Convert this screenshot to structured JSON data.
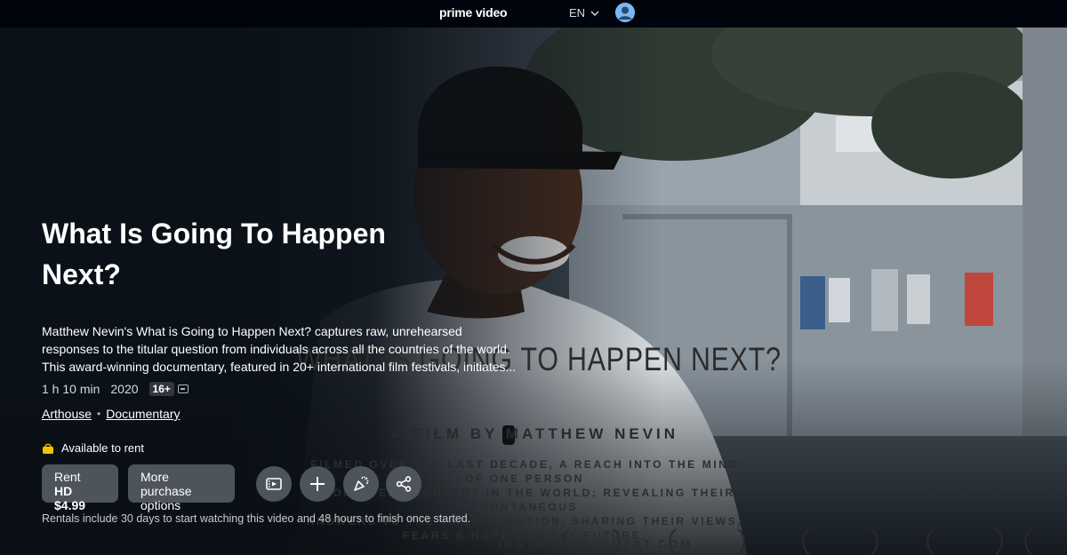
{
  "nav": {
    "brand": "prime video",
    "language": "EN"
  },
  "poster": {
    "title_text": "WHAT IS GOING TO HAPPEN NEXT?",
    "byline": "A FILM BY MATTHEW NEVIN",
    "description": "FILMED OVER THE LAST DECADE, A REACH INTO THE MIND OF ONE PERSON\nFROM EVERY COUNTRY IN THE WORLD; REVEALING THEIR SPONTANEOUS\nANSWERS TO THE TITLE QUESTION, SHARING THEIR VIEWS,\nFEARS & HOPE FOR THE FUTURE.",
    "url": "INGTOHAPPENNEXT.COM"
  },
  "detail": {
    "title": "What Is Going To Happen Next?",
    "synopsis": "Matthew Nevin's What is Going to Happen Next? captures raw, unrehearsed responses to the titular question from individuals across all the countries of the world. This award-winning documentary, featured in 20+ international film festivals, initiates...",
    "runtime": "1 h 10 min",
    "year": "2020",
    "rating": "16+",
    "genres": [
      "Arthouse",
      "Documentary"
    ],
    "availability": "Available to rent",
    "rent_line1": "Rent",
    "rent_line2": "HD $4.99",
    "more_purchase": "More purchase options",
    "rental_note": "Rentals include 30 days to start watching this video and 48 hours to finish once started."
  },
  "icons": {
    "language": "chevron-down-icon",
    "profile": "profile-avatar-icon",
    "availability": "shopping-bag-icon",
    "trailer": "trailer-icon",
    "watchlist": "plus-icon",
    "party": "watch-party-icon",
    "share": "share-icon"
  },
  "colors": {
    "nav_bg": "#00050d",
    "page_bg": "#0f171e",
    "button_bg": "#4e545b",
    "avatar": "#79b8f3",
    "availability_icon": "#f2c400"
  }
}
